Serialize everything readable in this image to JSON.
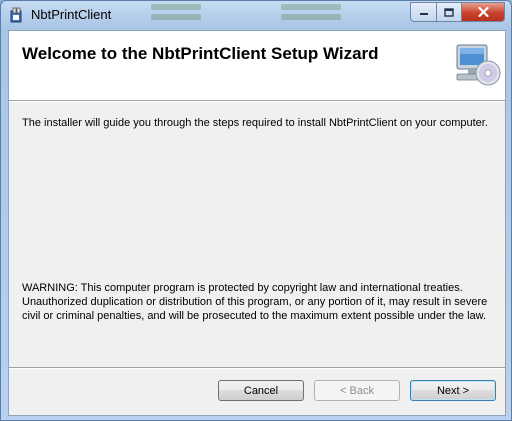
{
  "window": {
    "title": "NbtPrintClient"
  },
  "caption_buttons": {
    "minimize_icon": "minimize-icon",
    "maximize_icon": "maximize-icon",
    "close_icon": "close-icon"
  },
  "banner": {
    "title": "Welcome to the NbtPrintClient Setup Wizard",
    "icon": "computer-disc-icon"
  },
  "body": {
    "intro": "The installer will guide you through the steps required to install NbtPrintClient on your computer.",
    "warning": "WARNING: This computer program is protected by copyright law and international treaties. Unauthorized duplication or distribution of this program, or any portion of it, may result in severe civil or criminal penalties, and will be prosecuted to the maximum extent possible under the law."
  },
  "buttons": {
    "cancel": "Cancel",
    "back": "< Back",
    "next": "Next >"
  }
}
